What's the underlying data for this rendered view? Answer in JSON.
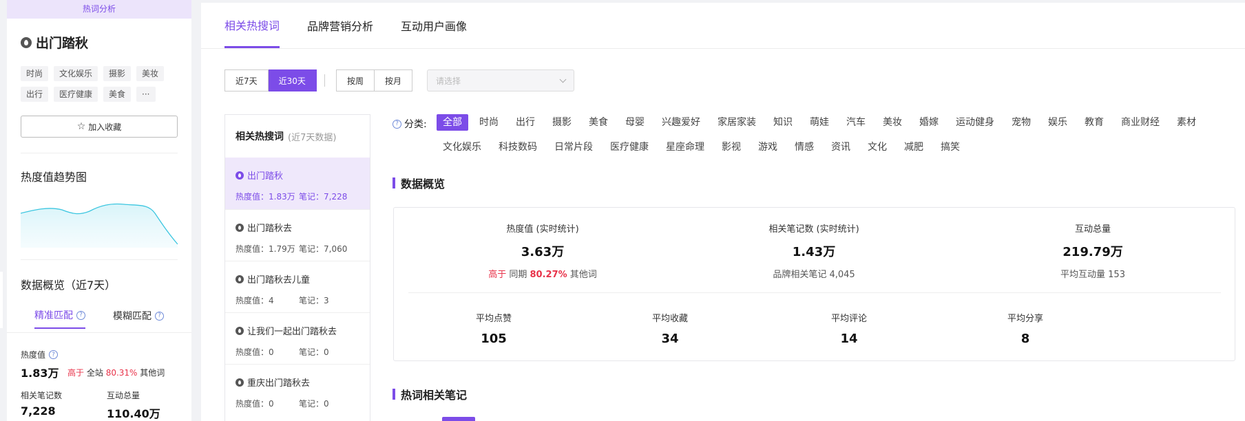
{
  "left": {
    "banner": "热词分析",
    "keyword": "出门踏秋",
    "tags": [
      "时尚",
      "文化娱乐",
      "摄影",
      "美妆",
      "出行",
      "医疗健康",
      "美食",
      "···"
    ],
    "favorite_label": "加入收藏",
    "trend_title": "热度值趋势图",
    "overview_title": "数据概览（近7天）",
    "match_tabs": [
      "精准匹配",
      "模糊匹配"
    ],
    "heat_label": "热度值",
    "heat_value": "1.83万",
    "higher_prefix": "高于",
    "higher_mid": "全站",
    "higher_pct": "80.31%",
    "higher_suffix": "其他词",
    "notes_label": "相关笔记数",
    "notes_value": "7,228",
    "interact_label": "互动总量",
    "interact_value": "110.40万"
  },
  "main": {
    "tabs": [
      "相关热搜词",
      "品牌营销分析",
      "互动用户画像"
    ],
    "range_buttons": [
      "近7天",
      "近30天"
    ],
    "period_buttons": [
      "按周",
      "按月"
    ],
    "select_placeholder": "请选择",
    "list_header": "相关热搜词",
    "list_header_note": "(近7天数据)",
    "keywords": [
      {
        "name": "出门踏秋",
        "heat": "热度值：1.83万",
        "notes": "笔记：7,228"
      },
      {
        "name": "出门踏秋去",
        "heat": "热度值：1.79万",
        "notes": "笔记：7,060"
      },
      {
        "name": "出门踏秋去儿童",
        "heat": "热度值：4",
        "notes": "笔记：3"
      },
      {
        "name": "让我们一起出门踏秋去",
        "heat": "热度值：0",
        "notes": "笔记：0"
      },
      {
        "name": "重庆出门踏秋去",
        "heat": "热度值：0",
        "notes": "笔记：0"
      }
    ],
    "category_label": "分类:",
    "categories": [
      "全部",
      "时尚",
      "出行",
      "摄影",
      "美食",
      "母婴",
      "兴趣爱好",
      "家居家装",
      "知识",
      "萌娃",
      "汽车",
      "美妆",
      "婚嫁",
      "运动健身",
      "宠物",
      "娱乐",
      "教育",
      "商业财经",
      "素材",
      "文化娱乐",
      "科技数码",
      "日常片段",
      "医疗健康",
      "星座命理",
      "影视",
      "游戏",
      "情感",
      "资讯",
      "文化",
      "减肥",
      "搞笑"
    ],
    "overview_title": "数据概览",
    "overview": {
      "heat_label": "热度值 (实时统计)",
      "heat_value": "3.63万",
      "heat_sub_prefix": "高于",
      "heat_sub_mid": "同期",
      "heat_sub_pct": "80.27%",
      "heat_sub_suffix": "其他词",
      "notes_label": "相关笔记数 (实时统计)",
      "notes_value": "1.43万",
      "notes_sub": "品牌相关笔记 4,045",
      "interact_label": "互动总量",
      "interact_value": "219.79万",
      "interact_sub": "平均互动量 153",
      "like_label": "平均点赞",
      "like_value": "105",
      "collect_label": "平均收藏",
      "collect_value": "34",
      "comment_label": "平均评论",
      "comment_value": "14",
      "share_label": "平均分享",
      "share_value": "8"
    },
    "notes_section_title": "热词相关笔记"
  },
  "colors": {
    "accent": "#7c4ce8",
    "highlight_red": "#e8334a",
    "trend_line": "#3cc6e0"
  }
}
